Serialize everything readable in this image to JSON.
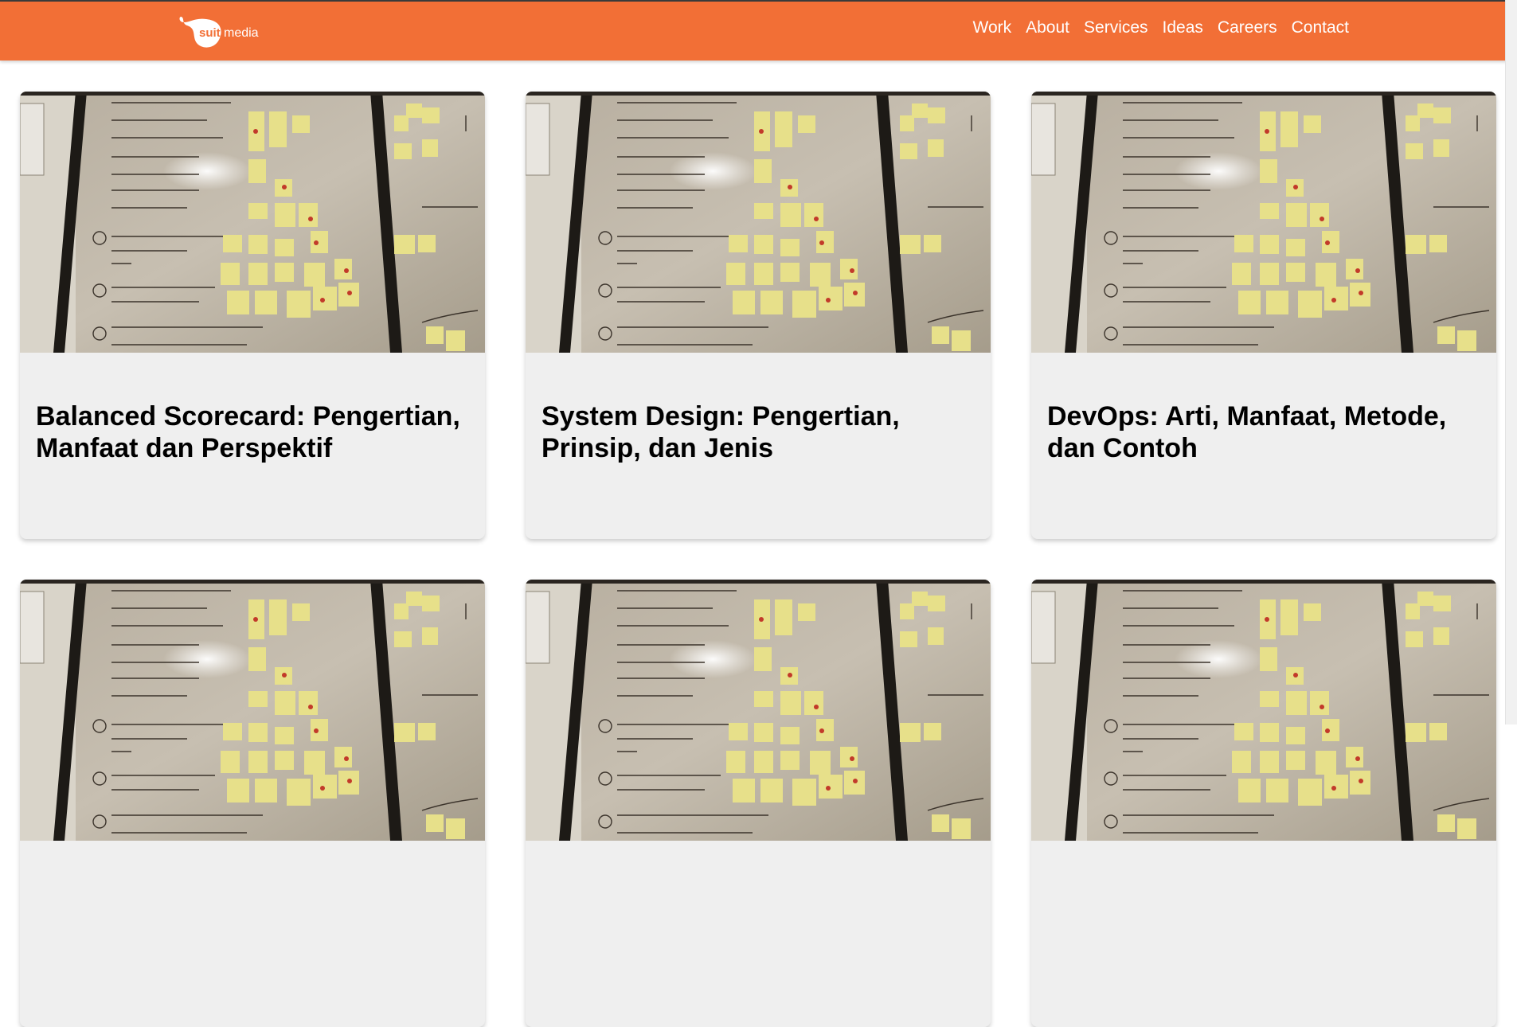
{
  "brand": {
    "logo_text": "suitmedia",
    "color": "#f26f36"
  },
  "nav": {
    "items": [
      {
        "label": "Work"
      },
      {
        "label": "About"
      },
      {
        "label": "Services"
      },
      {
        "label": "Ideas"
      },
      {
        "label": "Careers"
      },
      {
        "label": "Contact"
      }
    ]
  },
  "posts": [
    {
      "title": "Balanced Scorecard: Pengertian, Manfaat dan Perspektif",
      "image": "whiteboard-sticky-notes-photo"
    },
    {
      "title": "System Design: Pengertian, Prinsip, dan Jenis",
      "image": "whiteboard-sticky-notes-photo"
    },
    {
      "title": "DevOps: Arti, Manfaat, Metode, dan Contoh",
      "image": "whiteboard-sticky-notes-photo"
    },
    {
      "title": "",
      "image": "whiteboard-sticky-notes-photo"
    },
    {
      "title": "",
      "image": "whiteboard-sticky-notes-photo"
    },
    {
      "title": "",
      "image": "whiteboard-sticky-notes-photo"
    }
  ]
}
